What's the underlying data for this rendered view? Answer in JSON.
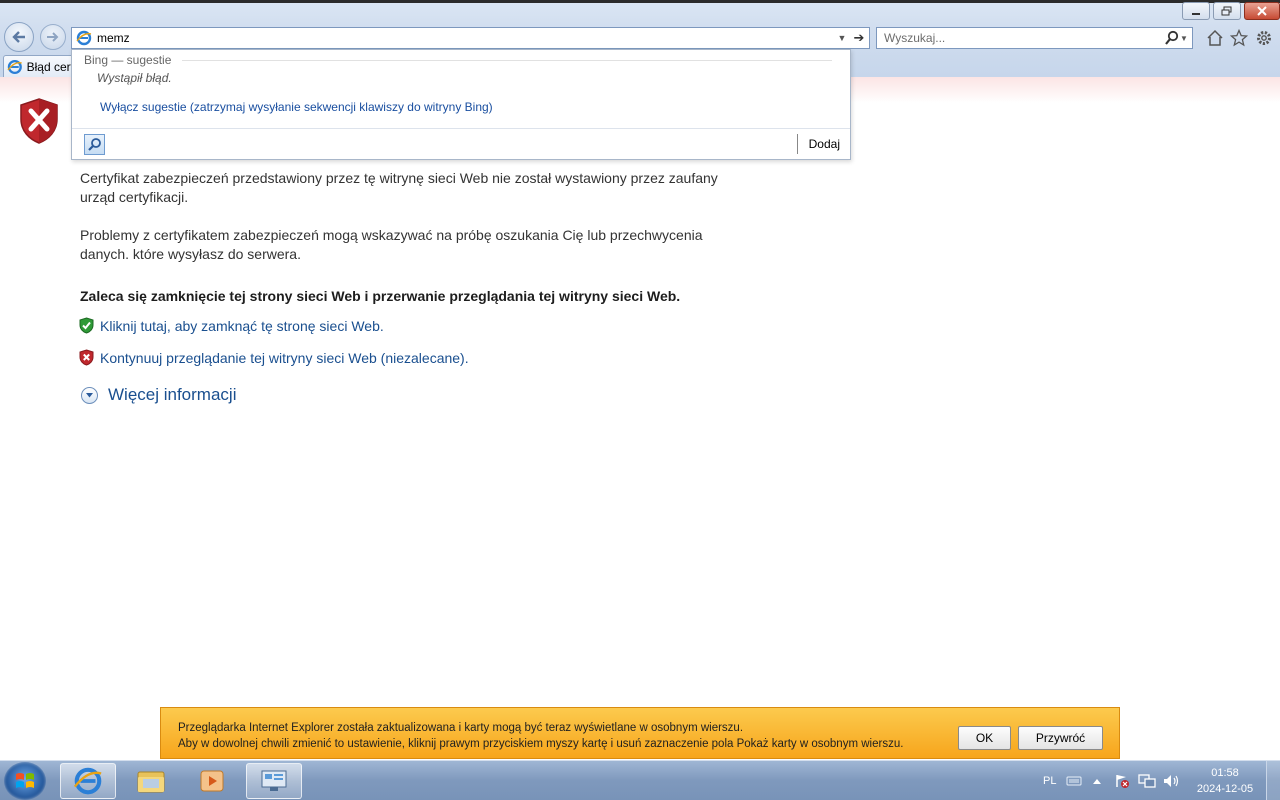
{
  "browser": {
    "address_value": "memz",
    "search_placeholder": "Wyszukaj...",
    "tab_title": "Błąd cert"
  },
  "suggestions": {
    "provider": "Bing — sugestie",
    "error": "Wystąpił błąd.",
    "disable_link": "Wyłącz sugestie (zatrzymaj wysyłanie sekwencji klawiszy do witryny Bing)",
    "add_label": "Dodaj"
  },
  "page": {
    "paragraph1": "Certyfikat zabezpieczeń przedstawiony przez tę witrynę sieci Web nie został wystawiony przez zaufany urząd certyfikacji.",
    "paragraph2": "Problemy z certyfikatem zabezpieczeń mogą wskazywać na próbę oszukania Cię lub przechwycenia danych. które wysyłasz do serwera.",
    "recommendation": "Zaleca się zamknięcie tej strony sieci Web i przerwanie przeglądania tej witryny sieci Web.",
    "close_link": "Kliknij tutaj, aby zamknąć tę stronę sieci Web.",
    "continue_link": "Kontynuuj przeglądanie tej witryny sieci Web (niezalecane).",
    "more_info": "Więcej informacji"
  },
  "notification": {
    "line1": "Przeglądarka Internet Explorer została zaktualizowana i karty mogą być teraz wyświetlane w osobnym wierszu.",
    "line2": "Aby w dowolnej chwili zmienić to ustawienie, kliknij prawym przyciskiem myszy kartę i usuń zaznaczenie pola Pokaż karty w osobnym wierszu.",
    "ok_label": "OK",
    "restore_label": "Przywróć"
  },
  "taskbar": {
    "language": "PL",
    "time": "01:58",
    "date": "2024-12-05"
  },
  "icons": [
    "back-icon",
    "forward-icon",
    "ie-icon",
    "home-icon",
    "favorites-star-icon",
    "settings-gear-icon",
    "shield-error-icon",
    "shield-check-icon",
    "search-icon"
  ],
  "colors": {
    "link": "#1a4f8f",
    "notification_bg": "#f9b632",
    "error_red": "#c0282d"
  }
}
